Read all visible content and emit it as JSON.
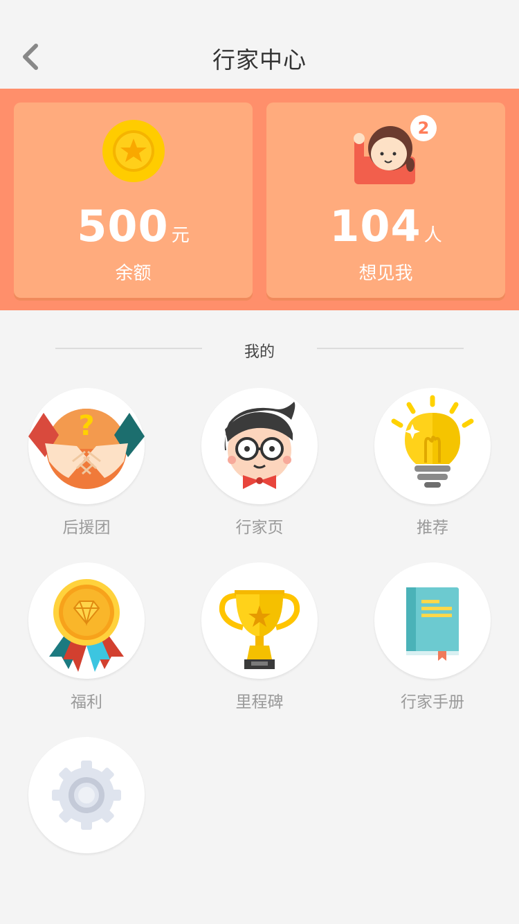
{
  "nav": {
    "title": "行家中心"
  },
  "cards": {
    "balance": {
      "value": "500",
      "unit": "元",
      "label": "余额"
    },
    "fans": {
      "value": "104",
      "unit": "人",
      "label": "想见我",
      "badge": "2"
    }
  },
  "section": {
    "title": "我的"
  },
  "grid": {
    "items": [
      {
        "label": "后援团",
        "icon": "handshake-question-icon"
      },
      {
        "label": "行家页",
        "icon": "expert-avatar-icon"
      },
      {
        "label": "推荐",
        "icon": "lightbulb-icon"
      },
      {
        "label": "福利",
        "icon": "medal-icon"
      },
      {
        "label": "里程碑",
        "icon": "trophy-icon"
      },
      {
        "label": "行家手册",
        "icon": "handbook-icon"
      },
      {
        "label": "",
        "icon": "gear-icon"
      }
    ]
  },
  "colors": {
    "banner": "#ff8f6b",
    "card": "#ffab7d",
    "background": "#f4f4f4"
  }
}
